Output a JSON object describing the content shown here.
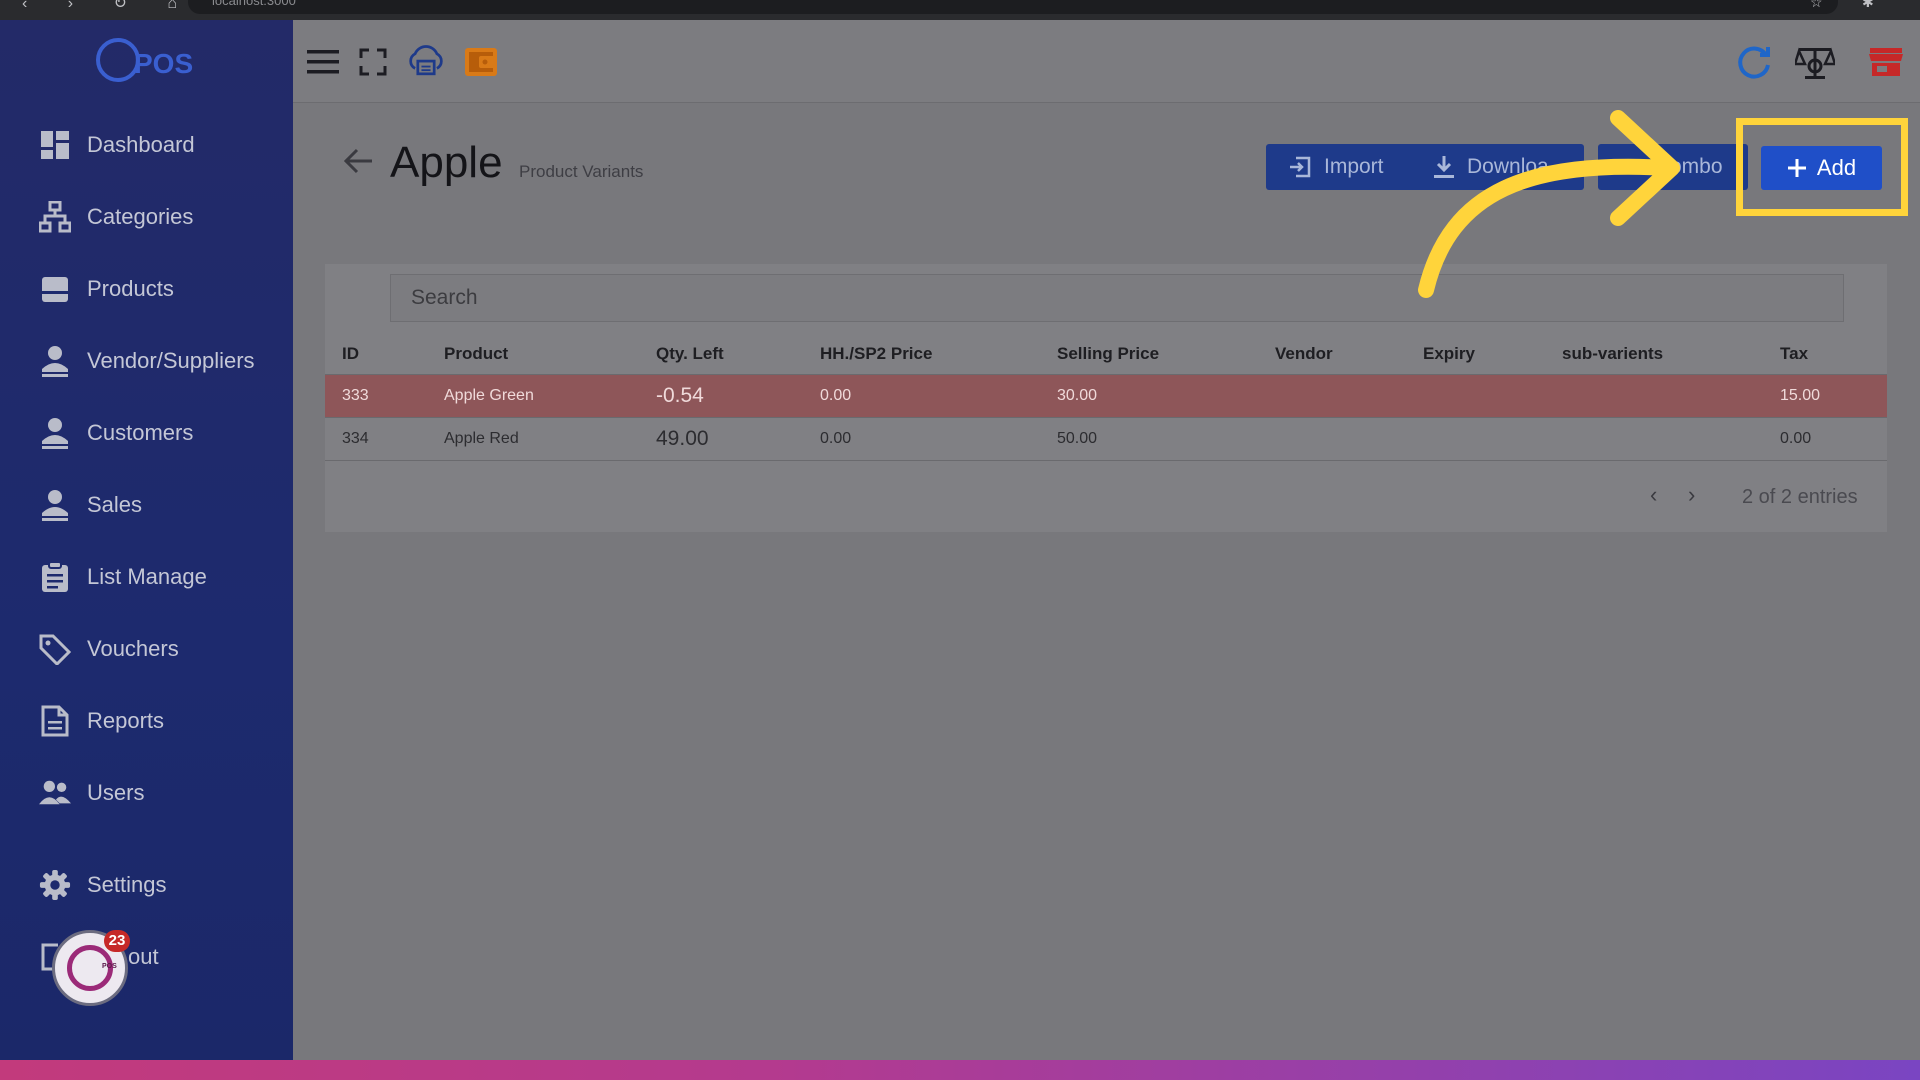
{
  "browser": {
    "url": "localhost:3000"
  },
  "brand": {
    "name": "POS",
    "mark": "rc"
  },
  "sidebar": {
    "items": [
      {
        "label": "Dashboard",
        "icon": "dashboard-icon"
      },
      {
        "label": "Categories",
        "icon": "sitemap-icon"
      },
      {
        "label": "Products",
        "icon": "box-icon"
      },
      {
        "label": "Vendor/Suppliers",
        "icon": "person-icon"
      },
      {
        "label": "Customers",
        "icon": "person-icon"
      },
      {
        "label": "Sales",
        "icon": "person-icon"
      },
      {
        "label": "List Manage",
        "icon": "clipboard-icon"
      },
      {
        "label": "Vouchers",
        "icon": "tag-icon"
      },
      {
        "label": "Reports",
        "icon": "document-icon"
      },
      {
        "label": "Users",
        "icon": "users-icon"
      },
      {
        "label": "Settings",
        "icon": "gear-icon"
      },
      {
        "label": "Logout",
        "visible_text": "out",
        "icon": "logout-icon"
      }
    ]
  },
  "notifications": {
    "count": "23"
  },
  "page": {
    "title": "Apple",
    "subtitle": "Product Variants"
  },
  "actions": {
    "import_label": "Import",
    "download_label": "Downloa",
    "combo_label": "ombo",
    "add_label": "Add"
  },
  "search": {
    "placeholder": "Search"
  },
  "table": {
    "columns": [
      "ID",
      "Product",
      "Qty. Left",
      "HH./SP2 Price",
      "Selling Price",
      "Vendor",
      "Expiry",
      "sub-varients",
      "Tax"
    ],
    "rows": [
      {
        "id": "333",
        "product": "Apple Green",
        "qty_left": "-0.54",
        "hh_sp2_price": "0.00",
        "selling_price": "30.00",
        "vendor": "",
        "expiry": "",
        "sub_variants": "",
        "tax": "15.00"
      },
      {
        "id": "334",
        "product": "Apple Red",
        "qty_left": "49.00",
        "hh_sp2_price": "0.00",
        "selling_price": "50.00",
        "vendor": "",
        "expiry": "",
        "sub_variants": "",
        "tax": "0.00"
      }
    ]
  },
  "pagination": {
    "prev": "‹",
    "next": "›",
    "summary": "2 of 2 entries"
  },
  "colors": {
    "sidebar_bg": "#1d2a6e",
    "primary_button": "#1e3a8a",
    "add_button": "#1f4fc8",
    "highlight": "#ffd43b",
    "negative_row": "#8e5659"
  }
}
